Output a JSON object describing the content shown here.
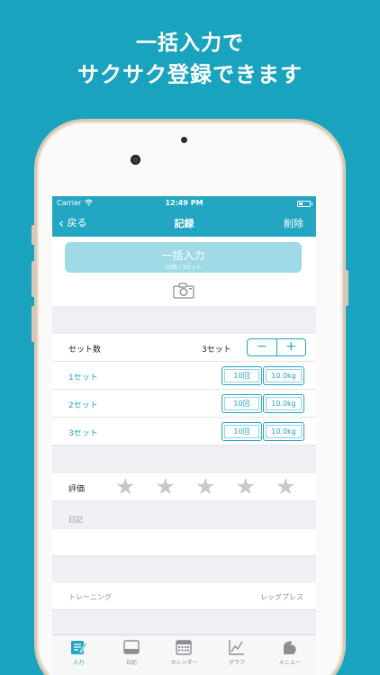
{
  "promo": {
    "line1": "一括入力で",
    "line2": "サクサク登録できます"
  },
  "status": {
    "carrier": "Carrier",
    "time": "12:49 PM"
  },
  "nav": {
    "back": "戻る",
    "title": "記録",
    "delete": "削除"
  },
  "bulk": {
    "label": "一括入力",
    "sub": "10回 / 3セット"
  },
  "sets": {
    "label": "セット数",
    "count": "3セット",
    "minus": "−",
    "plus": "+",
    "rows": [
      {
        "label": "1セット",
        "reps": "10回",
        "weight": "10.0kg"
      },
      {
        "label": "2セット",
        "reps": "10回",
        "weight": "10.0kg"
      },
      {
        "label": "3セット",
        "reps": "10回",
        "weight": "10.0kg"
      }
    ]
  },
  "rating": {
    "label": "評価",
    "stars": 0,
    "max": 5
  },
  "diary": {
    "label": "日記"
  },
  "training": {
    "label": "トレーニング",
    "value": "レッグプレス"
  },
  "tabs": [
    {
      "label": "入力",
      "icon": "pencil-note-icon",
      "active": true
    },
    {
      "label": "日記",
      "icon": "inbox-icon",
      "active": false
    },
    {
      "label": "カレンダー",
      "icon": "calendar-icon",
      "active": false
    },
    {
      "label": "グラフ",
      "icon": "line-graph-icon",
      "active": false
    },
    {
      "label": "メニュー",
      "icon": "muscle-arm-icon",
      "active": false
    }
  ],
  "colors": {
    "accent": "#22a6c1",
    "background": "#1aa3bf",
    "star": "#c8c8cc"
  }
}
